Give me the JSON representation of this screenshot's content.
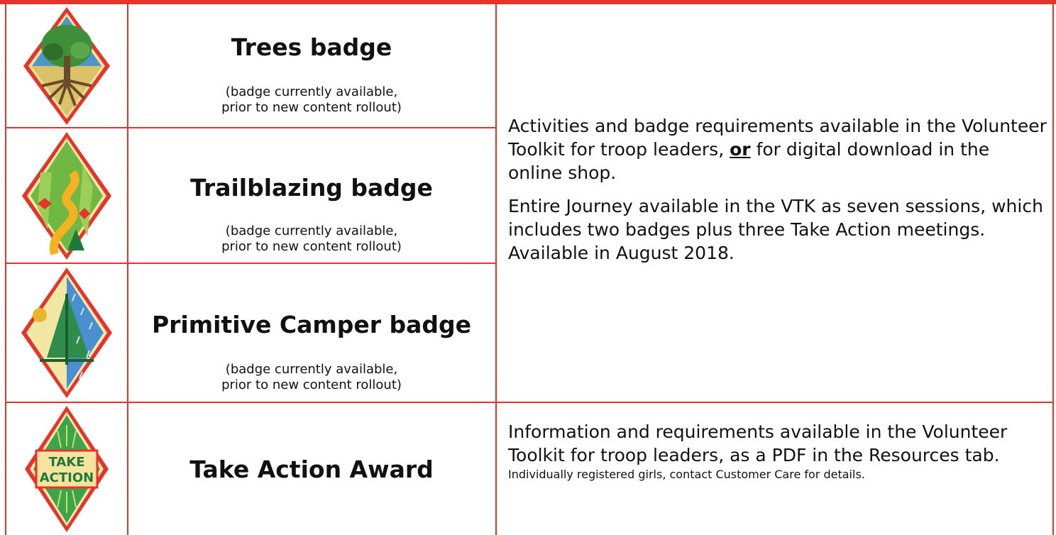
{
  "badges": [
    {
      "title": "Trees badge",
      "note_line1": "(badge currently available,",
      "note_line2": "prior to new content rollout)",
      "icon": "tree-badge-icon"
    },
    {
      "title": "Trailblazing badge",
      "note_line1": "(badge currently available,",
      "note_line2": "prior to new content rollout)",
      "icon": "trail-badge-icon"
    },
    {
      "title": "Primitive Camper badge",
      "note_line1": "(badge currently available,",
      "note_line2": "prior to new content rollout)",
      "icon": "tent-badge-icon"
    },
    {
      "title": "Take Action Award",
      "icon": "take-action-badge-icon",
      "icon_text_line1": "TAKE",
      "icon_text_line2": "ACTION"
    }
  ],
  "journey_description": {
    "p1_before": "Activities and badge requirements available in the Volunteer Toolkit for troop leaders,",
    "p1_emphasis": "or",
    "p1_after": "for digital download in the online shop.",
    "p2": "Entire Journey available in the VTK as seven sessions, which includes two badges plus three Take Action meetings. Available in August 2018."
  },
  "award_description": {
    "main": "Information and requirements available in the Volunteer Toolkit for troop leaders, as a PDF in the Resources tab.",
    "small": "Individually registered girls, contact Customer Care for details."
  },
  "colors": {
    "border": "#e5352a",
    "text": "#111111"
  }
}
